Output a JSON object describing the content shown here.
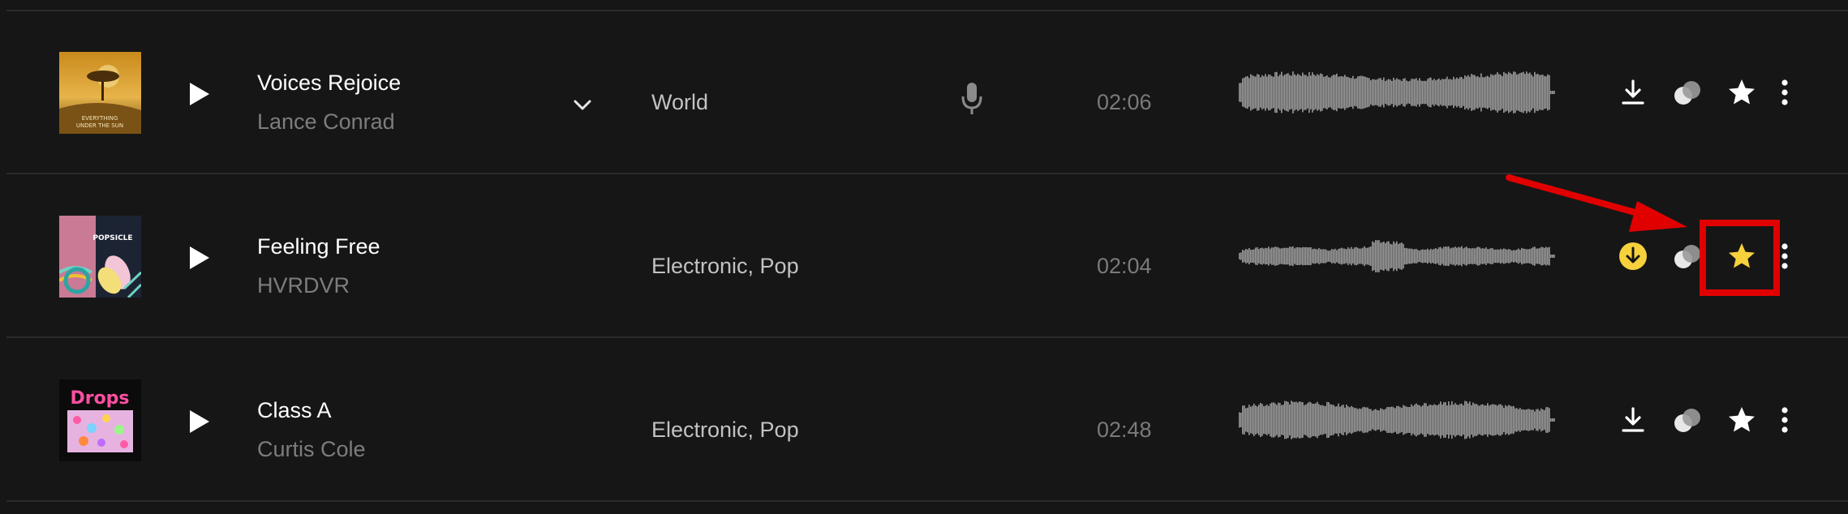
{
  "tracks": [
    {
      "title": "Voices Rejoice",
      "artist": "Lance Conrad",
      "genre": "World",
      "duration": "02:06",
      "has_vocals_icon": true,
      "expanded_chevron": true,
      "cover_text": [
        "EVERYTHING",
        "UNDER THE SUN"
      ],
      "download_state": "default",
      "favorite_state": "default"
    },
    {
      "title": "Feeling Free",
      "artist": "HVRDVR",
      "genre": "Electronic, Pop",
      "duration": "02:04",
      "has_vocals_icon": false,
      "expanded_chevron": false,
      "cover_text": [
        "POPSICLE"
      ],
      "download_state": "downloaded",
      "favorite_state": "favorited"
    },
    {
      "title": "Class A",
      "artist": "Curtis Cole",
      "genre": "Electronic, Pop",
      "duration": "02:48",
      "has_vocals_icon": false,
      "expanded_chevron": false,
      "cover_text": [
        "Drops"
      ],
      "download_state": "default",
      "favorite_state": "default"
    }
  ],
  "icons": {
    "play": "play-icon",
    "chevron": "chevron-down-icon",
    "mic": "microphone-icon",
    "download": "download-icon",
    "similar": "similar-tracks-icon",
    "favorite": "star-icon",
    "more": "more-vertical-icon"
  },
  "colors": {
    "background": "#161616",
    "divider": "#2b2b2b",
    "title": "#ffffff",
    "artist": "#7d7d7d",
    "genre": "#c2c2c2",
    "duration": "#7a7a7a",
    "waveform": "#9b9b9b",
    "accent_yellow": "#f6d13b",
    "annotation_red": "#e10000"
  }
}
